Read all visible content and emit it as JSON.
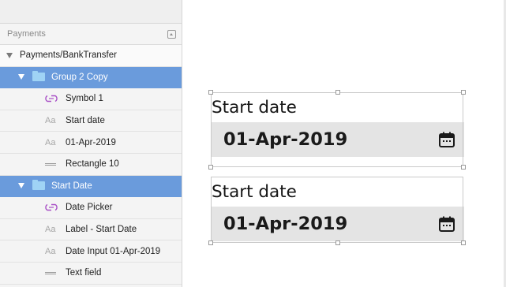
{
  "sidebar": {
    "section_title": "Payments",
    "page": {
      "name": "Payments/BankTransfer"
    },
    "groups": [
      {
        "name": "Group 2 Copy",
        "layers": [
          {
            "type": "symbol",
            "name": "Symbol 1",
            "icon": "symbol-icon"
          },
          {
            "type": "text",
            "name": "Start date",
            "icon_text": "Aa"
          },
          {
            "type": "text",
            "name": "01-Apr-2019",
            "icon_text": "Aa"
          },
          {
            "type": "shape",
            "name": "Rectangle 10",
            "icon": "rectangle-icon"
          }
        ]
      },
      {
        "name": "Start Date",
        "layers": [
          {
            "type": "symbol",
            "name": "Date Picker",
            "icon": "symbol-icon"
          },
          {
            "type": "text",
            "name": "Label - Start Date",
            "icon_text": "Aa"
          },
          {
            "type": "text",
            "name": "Date Input 01-Apr-2019",
            "icon_text": "Aa"
          },
          {
            "type": "shape",
            "name": "Text field",
            "icon": "rectangle-icon"
          }
        ]
      }
    ]
  },
  "canvas": {
    "components": [
      {
        "label": "Start date",
        "value": "01-Apr-2019",
        "icon": "calendar-icon"
      },
      {
        "label": "Start date",
        "value": "01-Apr-2019",
        "icon": "calendar-icon"
      }
    ]
  },
  "colors": {
    "selection": "#6a9bdc",
    "folder": "#9fd3f5",
    "symbol": "#a84fc6",
    "field_bg": "#e4e4e4"
  }
}
